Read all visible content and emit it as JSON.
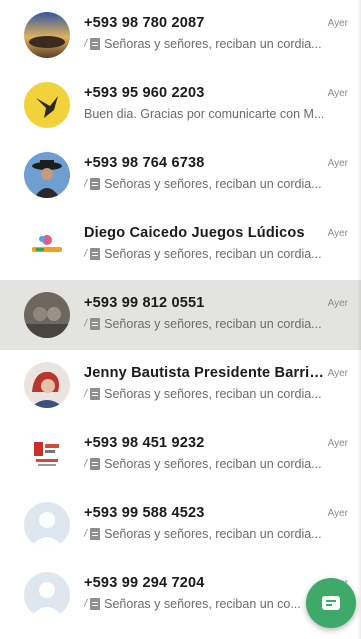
{
  "chats": [
    {
      "name": "+593 98 780 2087",
      "time": "Ayer",
      "preview": "Señoras y señores, reciban un cordia...",
      "ticks": "//",
      "doc": true,
      "avatar": "avatar-sunset",
      "highlighted": false
    },
    {
      "name": "+593 95 960 2203",
      "time": "Ayer",
      "preview": "Buen dia. Gracias por comunicarte con M...",
      "ticks": "",
      "doc": false,
      "avatar": "avatar-yellow-bird",
      "highlighted": false
    },
    {
      "name": "+593 98 764 6738",
      "time": "Ayer",
      "preview": "Señoras y señores, reciban un cordia...",
      "ticks": "//",
      "doc": true,
      "avatar": "avatar-hat-person",
      "highlighted": false
    },
    {
      "name": "Diego Caicedo Juegos Lúdicos",
      "time": "Ayer",
      "preview": "Señoras y señores, reciban un cordia...",
      "ticks": "//",
      "doc": true,
      "avatar": "avatar-logo",
      "highlighted": false
    },
    {
      "name": "+593 99 812 0551",
      "time": "Ayer",
      "preview": "Señoras y señores, reciban un cordia...",
      "ticks": "//",
      "doc": true,
      "avatar": "avatar-photo-dark",
      "highlighted": true
    },
    {
      "name": "Jenny Bautista Presidente Barrio...",
      "time": "Ayer",
      "preview": "Señoras y señores, reciban un cordia...",
      "ticks": "//",
      "doc": true,
      "avatar": "avatar-red-hair",
      "highlighted": false
    },
    {
      "name": "+593 98 451 9232",
      "time": "Ayer",
      "preview": "Señoras y señores, reciban un cordia...",
      "ticks": "//",
      "doc": true,
      "avatar": "avatar-flyer",
      "highlighted": false
    },
    {
      "name": "+593 99 588 4523",
      "time": "Ayer",
      "preview": "Señoras y señores, reciban un cordia...",
      "ticks": "//",
      "doc": true,
      "avatar": "avatar-default",
      "highlighted": false
    },
    {
      "name": "+593 99 294 7204",
      "time": "Ayer",
      "preview": "Señoras y señores, reciban un co...",
      "ticks": "//",
      "doc": true,
      "avatar": "avatar-default",
      "highlighted": false
    }
  ],
  "fab": {
    "icon": "new-chat-icon",
    "color": "#3fa96a"
  }
}
